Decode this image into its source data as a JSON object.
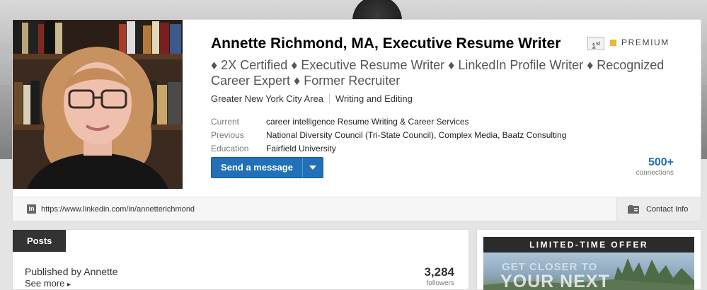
{
  "profile": {
    "name": "Annette Richmond, MA, Executive Resume Writer",
    "degree": "1",
    "degree_suffix": "st",
    "premium": "PREMIUM",
    "headline": "♦ 2X Certified ♦ Executive Resume Writer ♦ LinkedIn Profile Writer ♦ Recognized Career Expert ♦ Former Recruiter",
    "location": "Greater New York City Area",
    "industry": "Writing and Editing",
    "info": [
      {
        "label": "Current",
        "value": "career intelligence Resume Writing & Career Services"
      },
      {
        "label": "Previous",
        "value": "National Diversity Council (Tri-State Council), Complex Media, Baatz Consulting"
      },
      {
        "label": "Education",
        "value": "Fairfield University"
      }
    ],
    "send_message_label": "Send a message",
    "connections_count": "500+",
    "connections_label": "connections",
    "url": "https://www.linkedin.com/in/annetterichmond",
    "contact_info_label": "Contact Info"
  },
  "posts": {
    "tab_label": "Posts",
    "published_by": "Published by Annette",
    "see_more": "See more",
    "followers_count": "3,284",
    "followers_label": "followers"
  },
  "ad": {
    "header": "LIMITED-TIME OFFER",
    "line1": "GET CLOSER TO",
    "line2": "YOUR NEXT"
  },
  "colors": {
    "accent_blue": "#2270b7",
    "premium_gold": "#e7b633",
    "dark_tab": "#333333"
  },
  "icons": {
    "linkedin": "linkedin-icon",
    "contact": "contact-card-icon",
    "caret": "caret-down-icon",
    "see_more_chevron": "chevron-right-icon",
    "premium": "premium-badge-icon"
  }
}
